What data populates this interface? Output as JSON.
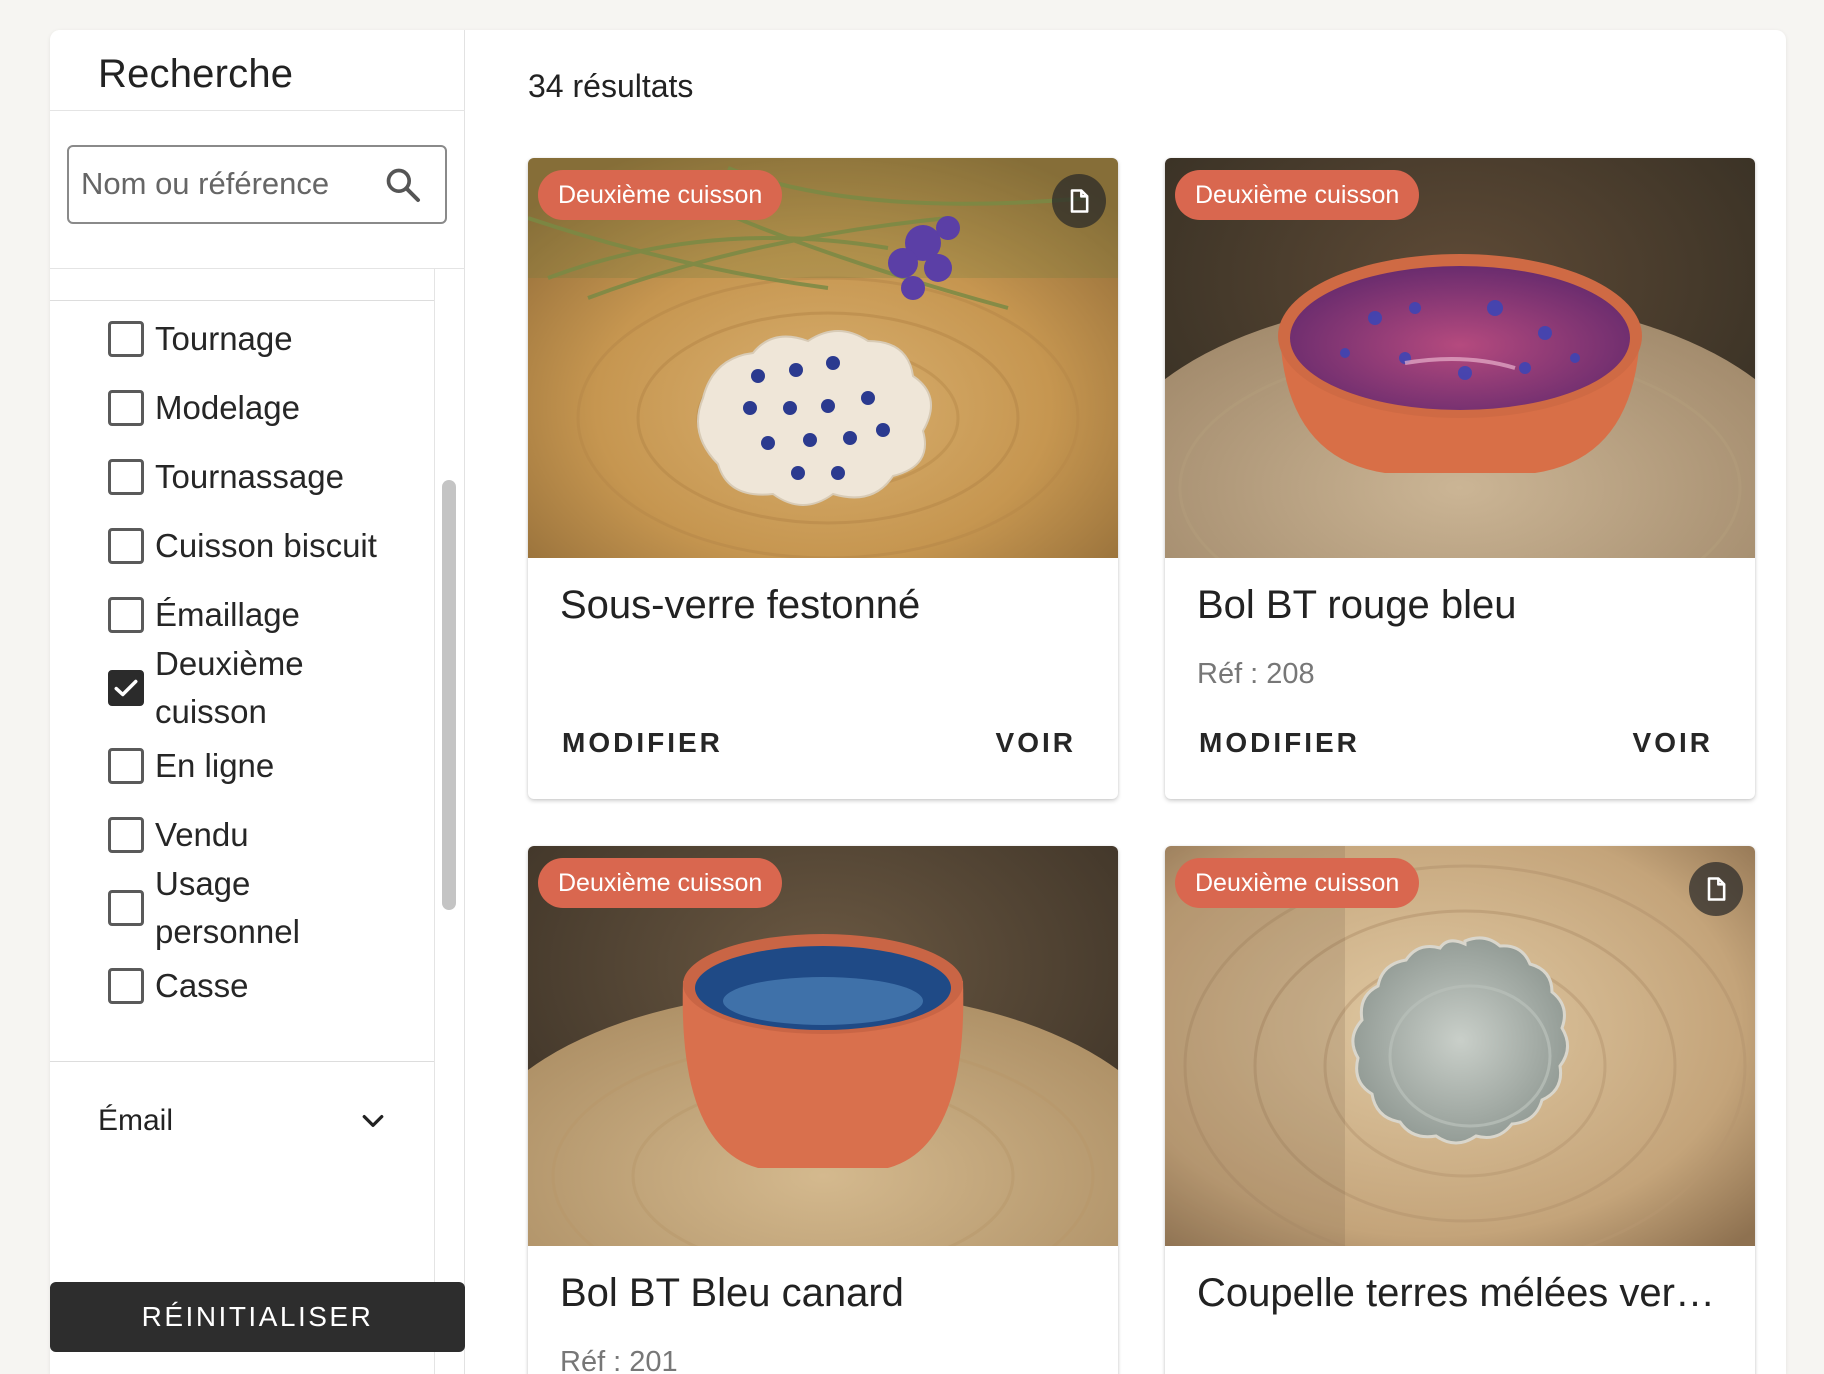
{
  "sidebar": {
    "title": "Recherche",
    "search": {
      "placeholder": "Nom ou référence",
      "value": ""
    },
    "filters": [
      {
        "label": "Tournage",
        "checked": false
      },
      {
        "label": "Modelage",
        "checked": false
      },
      {
        "label": "Tournassage",
        "checked": false
      },
      {
        "label": "Cuisson biscuit",
        "checked": false
      },
      {
        "label": "Émaillage",
        "checked": false
      },
      {
        "label": "Deuxième cuisson",
        "checked": true
      },
      {
        "label": "En ligne",
        "checked": false
      },
      {
        "label": "Vendu",
        "checked": false
      },
      {
        "label": "Usage personnel",
        "checked": false
      },
      {
        "label": "Casse",
        "checked": false
      }
    ],
    "email_section": {
      "label": "Émail",
      "expanded": false
    },
    "reset_label": "RÉINITIALISER"
  },
  "main": {
    "results_count": "34 résultats",
    "cards": [
      {
        "status": "Deuxième cuisson",
        "title": "Sous-verre festonné",
        "ref": "",
        "has_document": true,
        "modify_label": "MODIFIER",
        "view_label": "VOIR",
        "image": "cream-scalloped-coaster-with-blue-flowers"
      },
      {
        "status": "Deuxième cuisson",
        "title": "Bol BT rouge bleu",
        "ref": "Réf : 208",
        "has_document": false,
        "modify_label": "MODIFIER",
        "view_label": "VOIR",
        "image": "terracotta-bowl-with-purple-blue-glaze"
      },
      {
        "status": "Deuxième cuisson",
        "title": "Bol BT Bleu canard",
        "ref": "Réf : 201",
        "has_document": false,
        "image": "terracotta-bowl-with-teal-blue-glaze"
      },
      {
        "status": "Deuxième cuisson",
        "title": "Coupelle terres mélées ver…",
        "ref": "",
        "has_document": true,
        "image": "grey-marbled-scalloped-dish"
      }
    ]
  },
  "colors": {
    "status_chip": "#d9674f",
    "reset_button": "#2d2d2d",
    "page_background": "#f6f5f2"
  }
}
